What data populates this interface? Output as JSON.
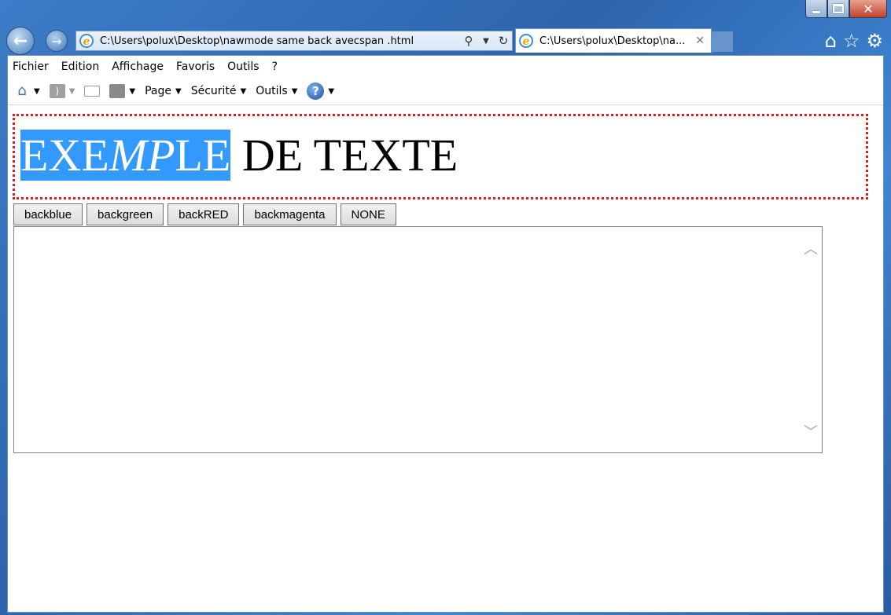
{
  "browser": {
    "address": "C:\\Users\\polux\\Desktop\\nawmode same back avecspan .html",
    "tab_title": "C:\\Users\\polux\\Desktop\\na...",
    "tab_close": "✕"
  },
  "menu": [
    "Fichier",
    "Edition",
    "Affichage",
    "Favoris",
    "Outils",
    "?"
  ],
  "commands": {
    "page": "Page",
    "security": "Sécurité",
    "tools": "Outils",
    "help": "?"
  },
  "heading": {
    "highlighted_before": "EXE",
    "highlighted_italic": "MP",
    "highlighted_after": "LE",
    "rest": " DE TEXTE"
  },
  "buttons": [
    "backblue",
    "backgreen",
    "backRED",
    "backmagenta",
    "NONE"
  ],
  "colors": {
    "highlight": "#3399ff",
    "dotted_border": "#e01b1b"
  }
}
